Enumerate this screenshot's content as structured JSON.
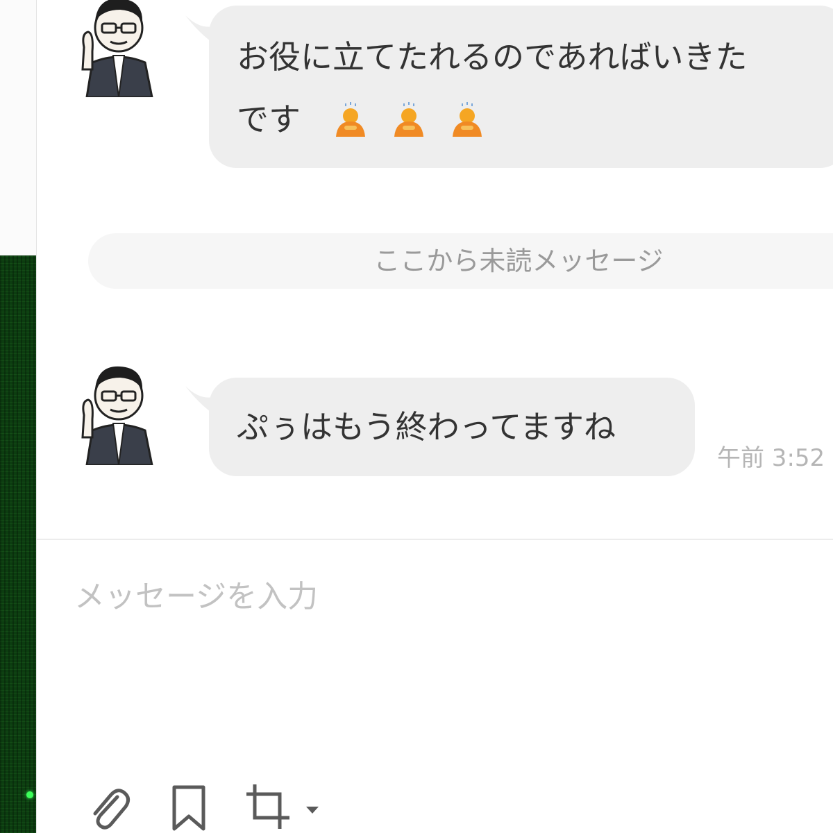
{
  "messages": [
    {
      "line1": "お役に立てたれるのであればいきた",
      "line2": "です",
      "emoji": [
        "person-bowing-icon",
        "person-bowing-icon",
        "person-bowing-icon"
      ]
    },
    {
      "text": "ぷぅはもう終わってますね",
      "time": "午前 3:52"
    }
  ],
  "unread_divider": "ここから未読メッセージ",
  "composer": {
    "placeholder": "メッセージを入力",
    "tools": [
      "paperclip-icon",
      "bookmark-icon",
      "crop-icon"
    ]
  },
  "colors": {
    "bubble": "#eeeeee",
    "text": "#333333",
    "muted": "#9a9a9a",
    "sidebar_green": "#0c3d10",
    "emoji_orange": "#f5a623"
  }
}
